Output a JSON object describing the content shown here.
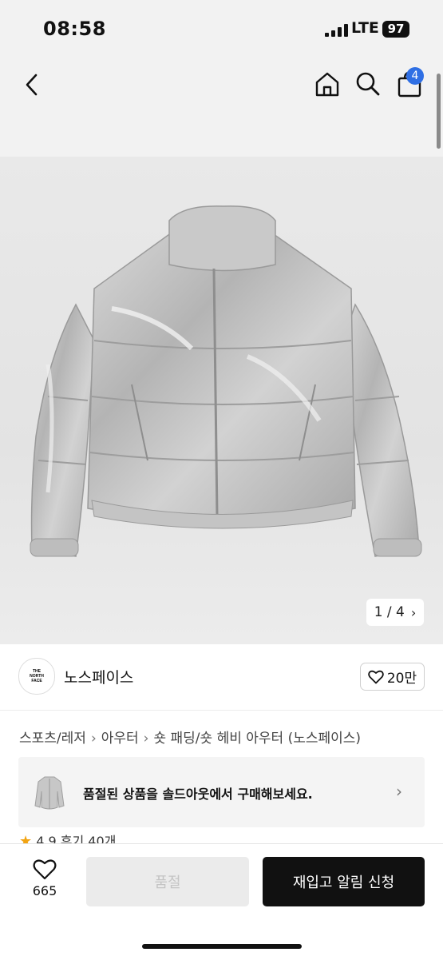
{
  "status_bar": {
    "time": "08:58",
    "network": "LTE",
    "battery": "97"
  },
  "nav": {
    "cart_count": "4"
  },
  "gallery": {
    "counter": "1 / 4"
  },
  "brand": {
    "logo_text": "THE NORTH FACE",
    "name": "노스페이스",
    "likes": "20만"
  },
  "breadcrumb": {
    "items": [
      "스포츠/레저",
      "아우터",
      "숏 패딩/숏 헤비 아우터 (노스페이스)"
    ]
  },
  "soldout_banner": {
    "text": "품절된 상품을 솔드아웃에서 구매해보세요."
  },
  "rating": {
    "score": "4.9",
    "reviews": "후기 40개"
  },
  "bottom_bar": {
    "wish_count": "665",
    "soldout_label": "품절",
    "restock_label": "재입고 알림 신청"
  },
  "colors": {
    "accent_badge": "#2f6fe4",
    "primary_button": "#111111",
    "disabled_button": "#ebebeb",
    "star": "#f2a413"
  },
  "icons": [
    "back-icon",
    "home-icon",
    "search-icon",
    "bag-icon",
    "heart-icon",
    "chevron-right-icon",
    "star-icon"
  ]
}
